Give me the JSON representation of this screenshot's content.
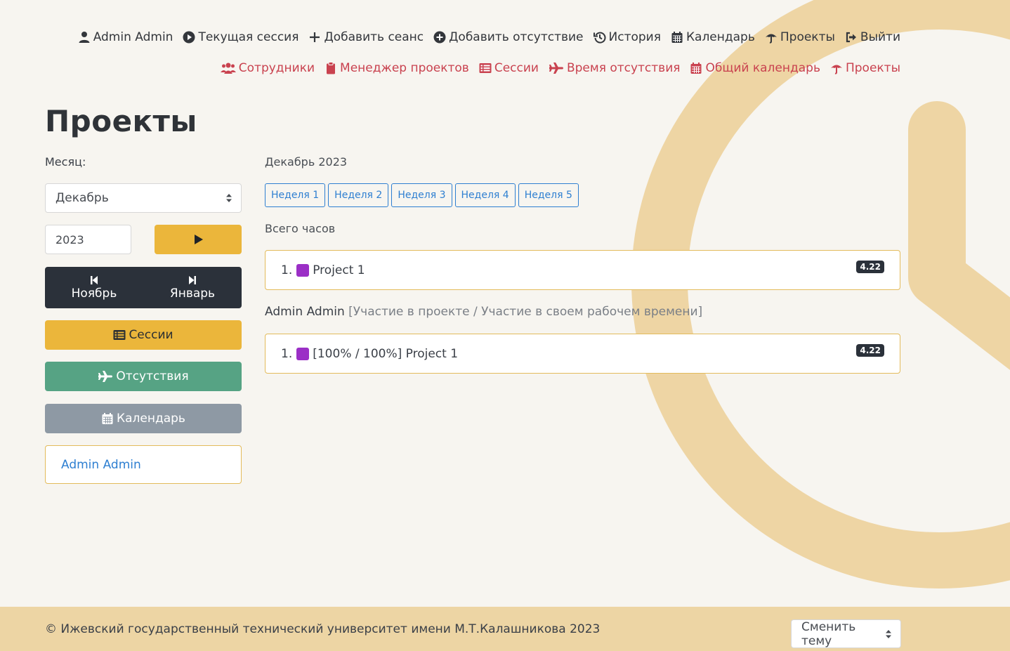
{
  "nav_top": [
    {
      "label": "Admin Admin",
      "icon": "user-icon"
    },
    {
      "label": "Текущая сессия",
      "icon": "play-circle-icon"
    },
    {
      "label": "Добавить сеанс",
      "icon": "plus-icon"
    },
    {
      "label": "Добавить отсутствие",
      "icon": "plus-circle-icon"
    },
    {
      "label": "История",
      "icon": "history-icon"
    },
    {
      "label": "Календарь",
      "icon": "calendar-icon"
    },
    {
      "label": "Проекты",
      "icon": "umbrella-icon"
    },
    {
      "label": "Выйти",
      "icon": "sign-out-icon"
    }
  ],
  "nav_admin": [
    {
      "label": "Сотрудники",
      "icon": "users-icon"
    },
    {
      "label": "Менеджер проектов",
      "icon": "clipboard-icon"
    },
    {
      "label": "Сессии",
      "icon": "list-icon"
    },
    {
      "label": "Время отсутствия",
      "icon": "plane-icon"
    },
    {
      "label": "Общий календарь",
      "icon": "calendar-icon"
    },
    {
      "label": "Проекты",
      "icon": "umbrella-icon"
    }
  ],
  "page_title": "Проекты",
  "sidebar": {
    "month_label": "Месяц:",
    "month_value": "Декабрь",
    "year_value": "2023",
    "prev_month": "Ноябрь",
    "next_month": "Январь",
    "sessions_button": "Сессии",
    "absences_button": "Отсутствия",
    "calendar_button": "Календарь",
    "user_link": "Admin Admin"
  },
  "main": {
    "period": "Декабрь 2023",
    "weeks": [
      "Неделя 1",
      "Неделя 2",
      "Неделя 3",
      "Неделя 4",
      "Неделя 5"
    ],
    "total_label": "Всего часов",
    "totals": [
      {
        "num": "1.",
        "name": "Project 1",
        "hours": "4.22",
        "color": "#9b2fc6"
      }
    ],
    "user_name": "Admin Admin",
    "user_note": "[Участие в проекте / Участие в своем рабочем времени]",
    "user_projects": [
      {
        "num": "1.",
        "name": "[100% / 100%] Project 1",
        "hours": "4.22",
        "color": "#9b2fc6"
      }
    ]
  },
  "footer": {
    "copyright": "© Ижевский государственный технический университет имени М.Т.Калашникова 2023",
    "theme_select": "Сменить тему"
  },
  "colors": {
    "accent_yellow": "#ebb63b",
    "nav_red": "#c9424f",
    "link_blue": "#2e7fd1",
    "dark": "#2b313a",
    "green": "#56a384",
    "gray": "#8e99a4",
    "footer_bg": "#edd5a4"
  }
}
